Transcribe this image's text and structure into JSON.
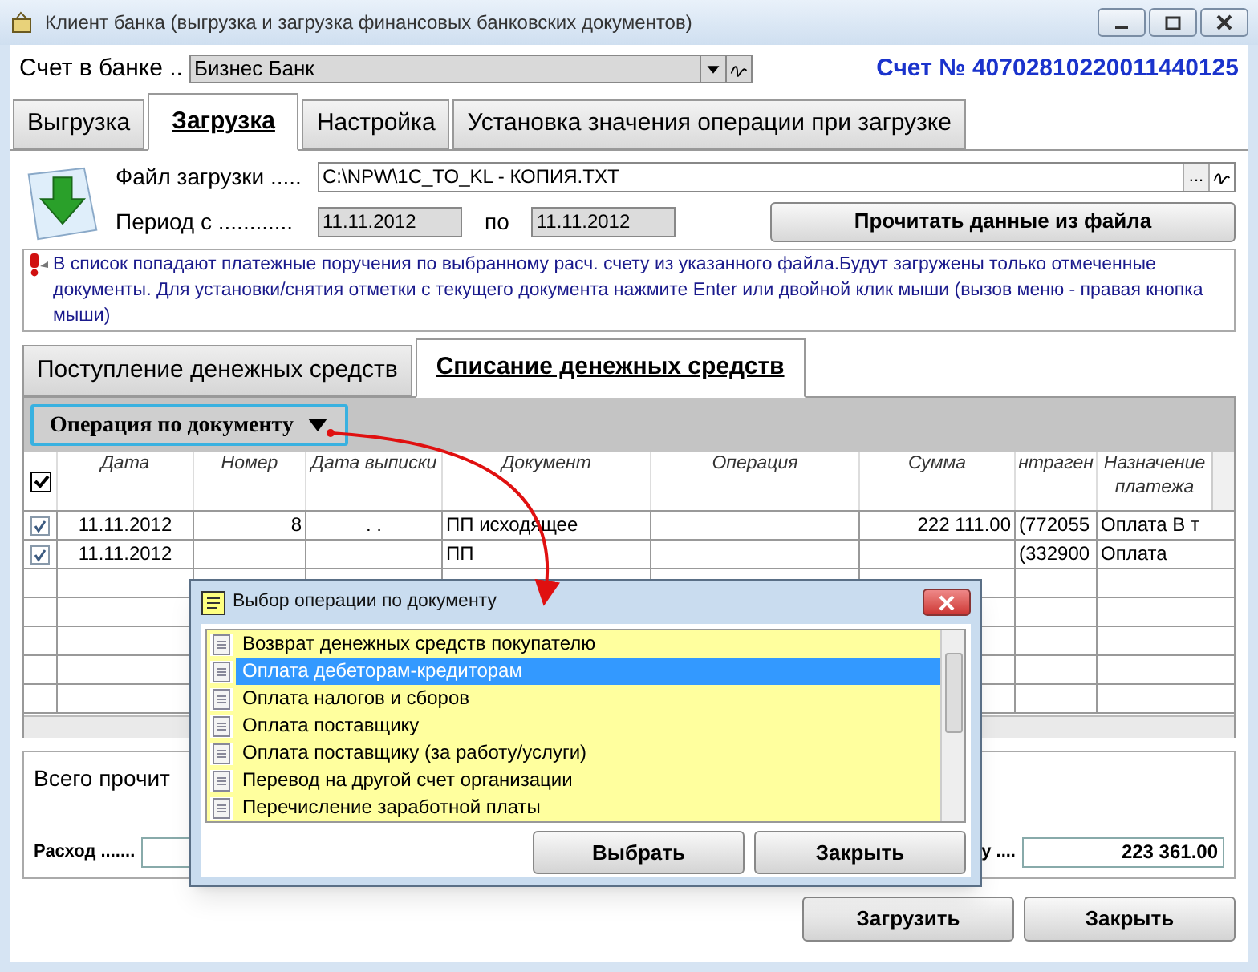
{
  "window": {
    "title": "Клиент банка (выгрузка и загрузка финансовых банковских документов)"
  },
  "account": {
    "label": "Счет в банке ..",
    "bank": "Бизнес Банк",
    "number": "Счет № 40702810220011440125"
  },
  "tabs": [
    {
      "label": "Выгрузка",
      "selected": false
    },
    {
      "label": "Загрузка",
      "selected": true
    },
    {
      "label": "Настройка",
      "selected": false
    },
    {
      "label": "Установка значения операции при загрузке",
      "selected": false
    }
  ],
  "file": {
    "label": "Файл загрузки .....",
    "value": "C:\\NPW\\1C_TO_KL - КОПИЯ.TXT",
    "browse": "..."
  },
  "period": {
    "label": "Период с ............",
    "from": "11.11.2012",
    "to_label": "по",
    "to": "11.11.2012"
  },
  "read_button": "Прочитать данные из файла",
  "info": "В список попадают платежные поручения по выбранному расч. счету из указанного файла.Будут загружены только отмеченные документы. Для установки/снятия отметки  с текущего документа нажмите Enter или двойной клик мыши (вызов меню - правая  кнопка мыши)",
  "subtabs": [
    {
      "label": "Поступление денежных средств",
      "selected": false
    },
    {
      "label": "Списание денежных средств",
      "selected": true
    }
  ],
  "operation_button": "Операция по документу",
  "table": {
    "all_checked": true,
    "columns": [
      "Дата",
      "Номер",
      "Дата выписки",
      "Документ",
      "Операция",
      "Сумма",
      "нтраген",
      "Назначение платежа"
    ],
    "rows": [
      {
        "checked": true,
        "cells": [
          "11.11.2012",
          "8",
          ". .",
          "ПП исходящее",
          "",
          "222 111.00",
          "(772055",
          "Оплата В т"
        ]
      },
      {
        "checked": true,
        "cells": [
          "11.11.2012",
          "",
          "",
          "ПП",
          "",
          "",
          "(332900",
          "Оплата"
        ]
      }
    ]
  },
  "summary": {
    "title": "Всего прочит",
    "expense_label": "Расход .......",
    "total_label": "у ....",
    "total": "223 361.00"
  },
  "buttons": [
    "Загрузить",
    "Закрыть"
  ],
  "dialog": {
    "title": "Выбор операции по документу",
    "items": [
      {
        "label": "Возврат денежных средств покупателю",
        "selected": false
      },
      {
        "label": "Оплата дебеторам-кредиторам",
        "selected": true
      },
      {
        "label": "Оплата налогов и сборов",
        "selected": false
      },
      {
        "label": "Оплата поставщику",
        "selected": false
      },
      {
        "label": "Оплата поставщику (за работу/услуги)",
        "selected": false
      },
      {
        "label": "Перевод на другой счет организации",
        "selected": false
      },
      {
        "label": "Перечисление заработной платы",
        "selected": false
      }
    ],
    "buttons": [
      "Выбрать",
      "Закрыть"
    ]
  }
}
